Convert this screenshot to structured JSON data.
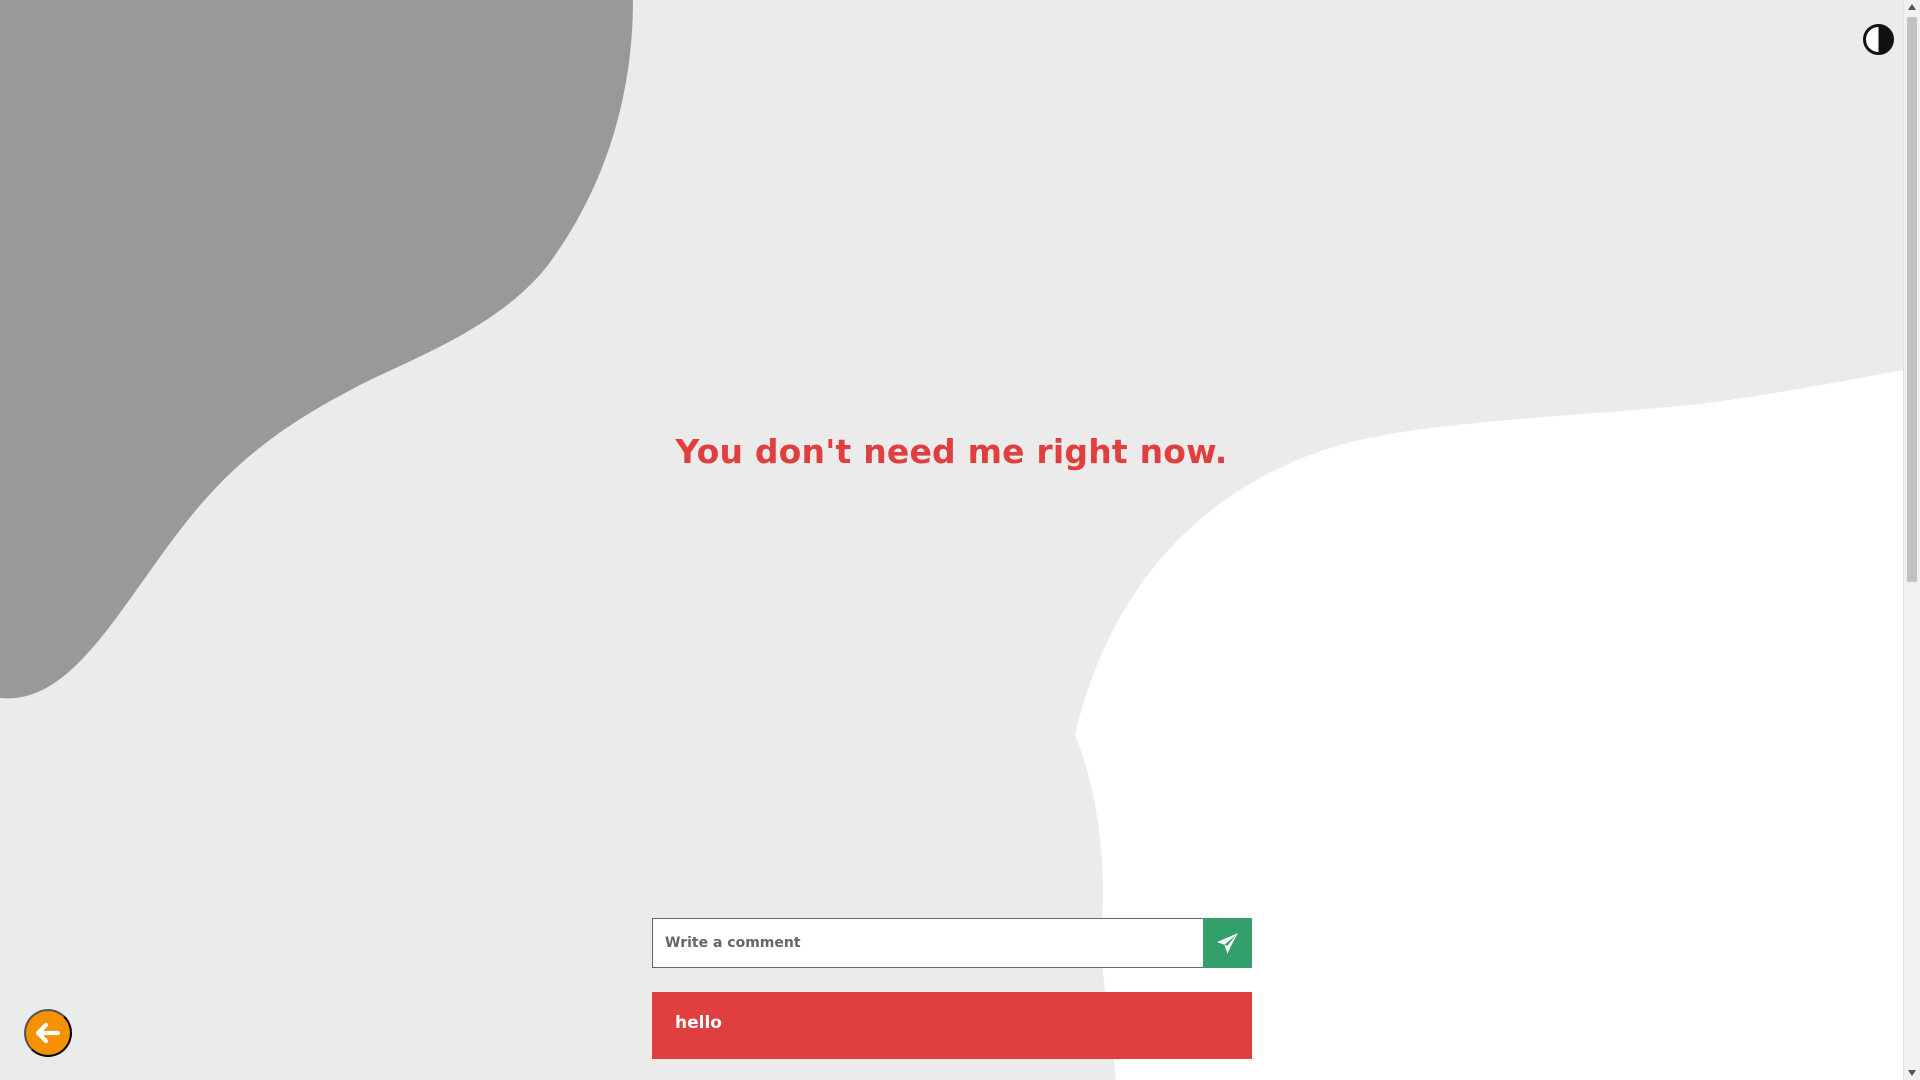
{
  "page": {
    "headline": "You don't need me right now."
  },
  "comment": {
    "placeholder": "Write a comment",
    "send_icon": "paper-plane-icon"
  },
  "comments": [
    {
      "text": "hello"
    }
  ],
  "controls": {
    "theme_toggle_icon": "contrast-icon",
    "back_icon": "arrow-left-icon"
  },
  "colors": {
    "background": "#ebebeb",
    "blob_gray": "#999999",
    "blob_white": "#ffffff",
    "headline": "#df3f3f",
    "send_button": "#33a06c",
    "comment_card": "#df3f3f",
    "back_button": "#f59100"
  }
}
